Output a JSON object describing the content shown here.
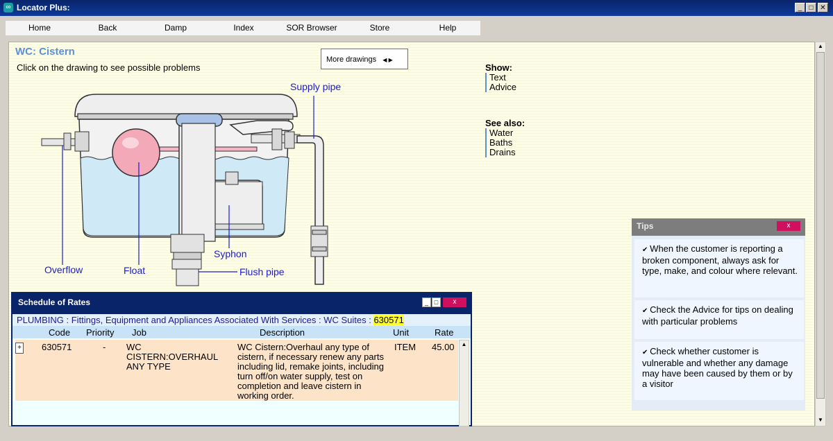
{
  "window": {
    "title": "Locator Plus:"
  },
  "menu": [
    "Home",
    "Back",
    "Damp",
    "Index",
    "SOR Browser",
    "Store",
    "Help"
  ],
  "page": {
    "title": "WC: Cistern",
    "instructions": "Click on the drawing to see possible problems",
    "more_drawings": "More drawings"
  },
  "diagram_labels": {
    "supply": "Supply pipe",
    "overflow": "Overflow",
    "float": "Float",
    "syphon": "Syphon",
    "flush": "Flush pipe"
  },
  "show": {
    "heading": "Show:",
    "items": [
      "Text",
      "Advice"
    ]
  },
  "see_also": {
    "heading": "See also:",
    "items": [
      "Water",
      "Baths",
      "Drains"
    ]
  },
  "tips": {
    "title": "Tips",
    "close": "x",
    "items": [
      "When the customer is reporting a broken component, always ask for type, make, and colour where relevant.",
      "Check the Advice for tips on dealing with particular problems",
      "Check whether customer is vulnerable and whether any damage may have been caused by them or by a visitor"
    ]
  },
  "schedule": {
    "title": "Schedule of Rates",
    "close": "x",
    "breadcrumb": "PLUMBING : Fittings, Equipment and Appliances Associated With Services : WC Suites : ",
    "breadcrumb_code": "630571",
    "columns": [
      "Code",
      "Priority",
      "Job",
      "Description",
      "Unit",
      "Rate"
    ],
    "row": {
      "code": "630571",
      "priority": "-",
      "job": "WC CISTERN:OVERHAUL ANY TYPE",
      "description": "WC Cistern:Overhaul any type of cistern, if necessary renew any parts including lid, remake joints, including turn off/on water supply, test on completion and leave cistern in working order.",
      "unit": "ITEM",
      "rate": "45.00"
    }
  },
  "colors": {
    "title_bar": "#0a246a",
    "accent_blue": "#5b8fd6",
    "close_pink": "#d0105f",
    "highlight": "#ffff33"
  }
}
